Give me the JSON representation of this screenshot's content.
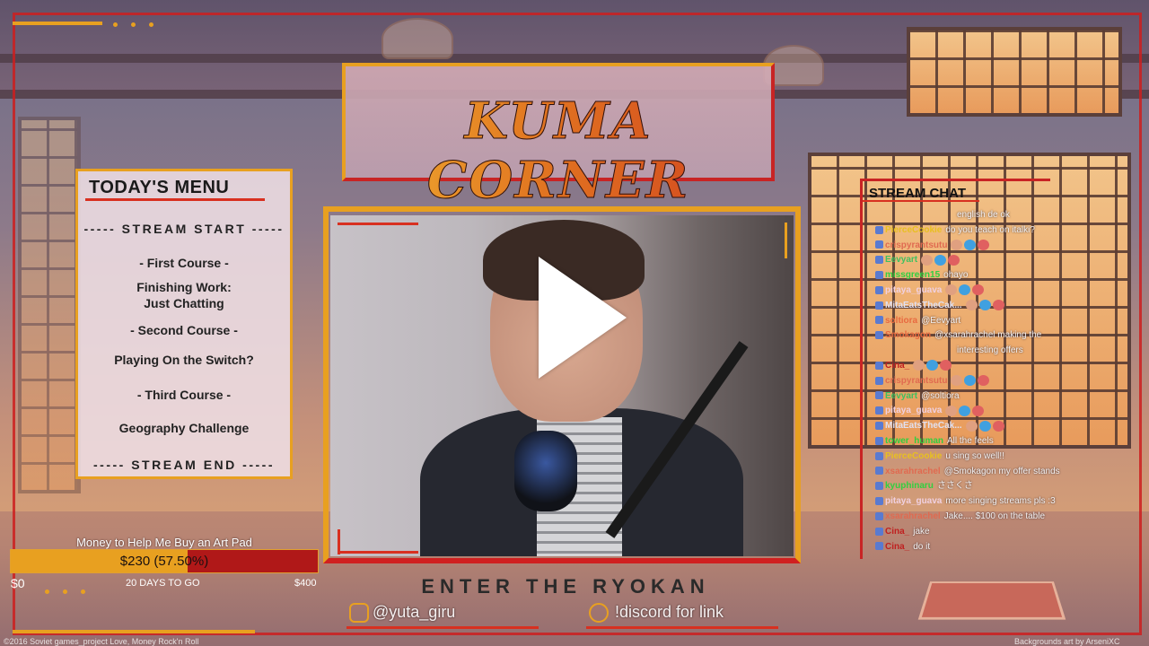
{
  "title": "KUMA CORNER",
  "menu": {
    "heading": "TODAY'S MENU",
    "items": [
      {
        "text": "----- STREAM START -----",
        "section": true
      },
      {
        "text": "- First Course -",
        "section": false
      },
      {
        "text": "Finishing Work:",
        "section": false
      },
      {
        "text": "Just Chatting",
        "section": false
      },
      {
        "text": "- Second Course -",
        "section": false
      },
      {
        "text": "Playing On the Switch?",
        "section": false
      },
      {
        "text": "- Third Course -",
        "section": false
      },
      {
        "text": "Geography Challenge",
        "section": false
      },
      {
        "text": "----- STREAM END -----",
        "section": true
      }
    ]
  },
  "chat": {
    "heading": "STREAM CHAT",
    "messages": [
      {
        "user": "",
        "text": "english de ok",
        "color": "#f0e0e0"
      },
      {
        "user": "PierceCookie",
        "text": "do you teach on italki?",
        "color": "#e8c020"
      },
      {
        "user": "crispyrantsutu",
        "text": "",
        "color": "#e06a50"
      },
      {
        "user": "Eevyart",
        "text": "",
        "color": "#40c060"
      },
      {
        "user": "missgreen15",
        "text": "ohayo",
        "color": "#30d040"
      },
      {
        "user": "pitaya_guava",
        "text": "",
        "color": "#f0d0e0"
      },
      {
        "user": "MitaEatsTheCak...",
        "text": "",
        "color": "#e0e0f0"
      },
      {
        "user": "soltiora",
        "text": "@Eevyart",
        "color": "#e86a40"
      },
      {
        "user": "Smokagon",
        "text": "@xsarahrachel making the",
        "color": "#e86a40"
      },
      {
        "user": "",
        "text": "interesting offers",
        "color": "#f0e0e0"
      },
      {
        "user": "Cina_",
        "text": "",
        "color": "#c02020"
      },
      {
        "user": "crispyrantsutu",
        "text": "",
        "color": "#e06a50"
      },
      {
        "user": "Eevyart",
        "text": "@soltiora",
        "color": "#40c060"
      },
      {
        "user": "pitaya_guava",
        "text": "",
        "color": "#f0d0e0"
      },
      {
        "user": "MitaEatsTheCak...",
        "text": "",
        "color": "#e0e0f0"
      },
      {
        "user": "tower_human",
        "text": "All the feels",
        "color": "#30d040"
      },
      {
        "user": "PierceCookie",
        "text": "u sing so well!!",
        "color": "#e8c020"
      },
      {
        "user": "xsarahrachel",
        "text": "@Smokagon my offer stands",
        "color": "#e06a50"
      },
      {
        "user": "kyuphinaru",
        "text": "ささくさ",
        "color": "#30d040"
      },
      {
        "user": "pitaya_guava",
        "text": "more singing streams pls :3",
        "color": "#f0d0e0"
      },
      {
        "user": "xsarahrachel",
        "text": "Jake.... $100 on the table",
        "color": "#e06a50"
      },
      {
        "user": "Cina_",
        "text": "jake",
        "color": "#c02020"
      },
      {
        "user": "Cina_",
        "text": "do it",
        "color": "#c02020"
      }
    ]
  },
  "goal": {
    "label": "Money to Help Me Buy an Art Pad",
    "amount": "$230 (57.50%)",
    "progress_percent": 57.5,
    "min": "$0",
    "days": "20 DAYS TO GO",
    "max": "$400"
  },
  "tagline": "ENTER THE RYOKAN",
  "socials": {
    "instagram": "@yuta_giru",
    "discord": "!discord for link"
  },
  "footer": {
    "left": "©2016 Soviet games_project Love, Money Rock'n Roll",
    "right": "Backgrounds art by ArseniXC"
  },
  "colors": {
    "accent": "#e8a020",
    "frame_red": "#c82424"
  },
  "icons": {
    "play": "play-icon",
    "instagram": "instagram-icon",
    "discord": "discord-icon"
  }
}
